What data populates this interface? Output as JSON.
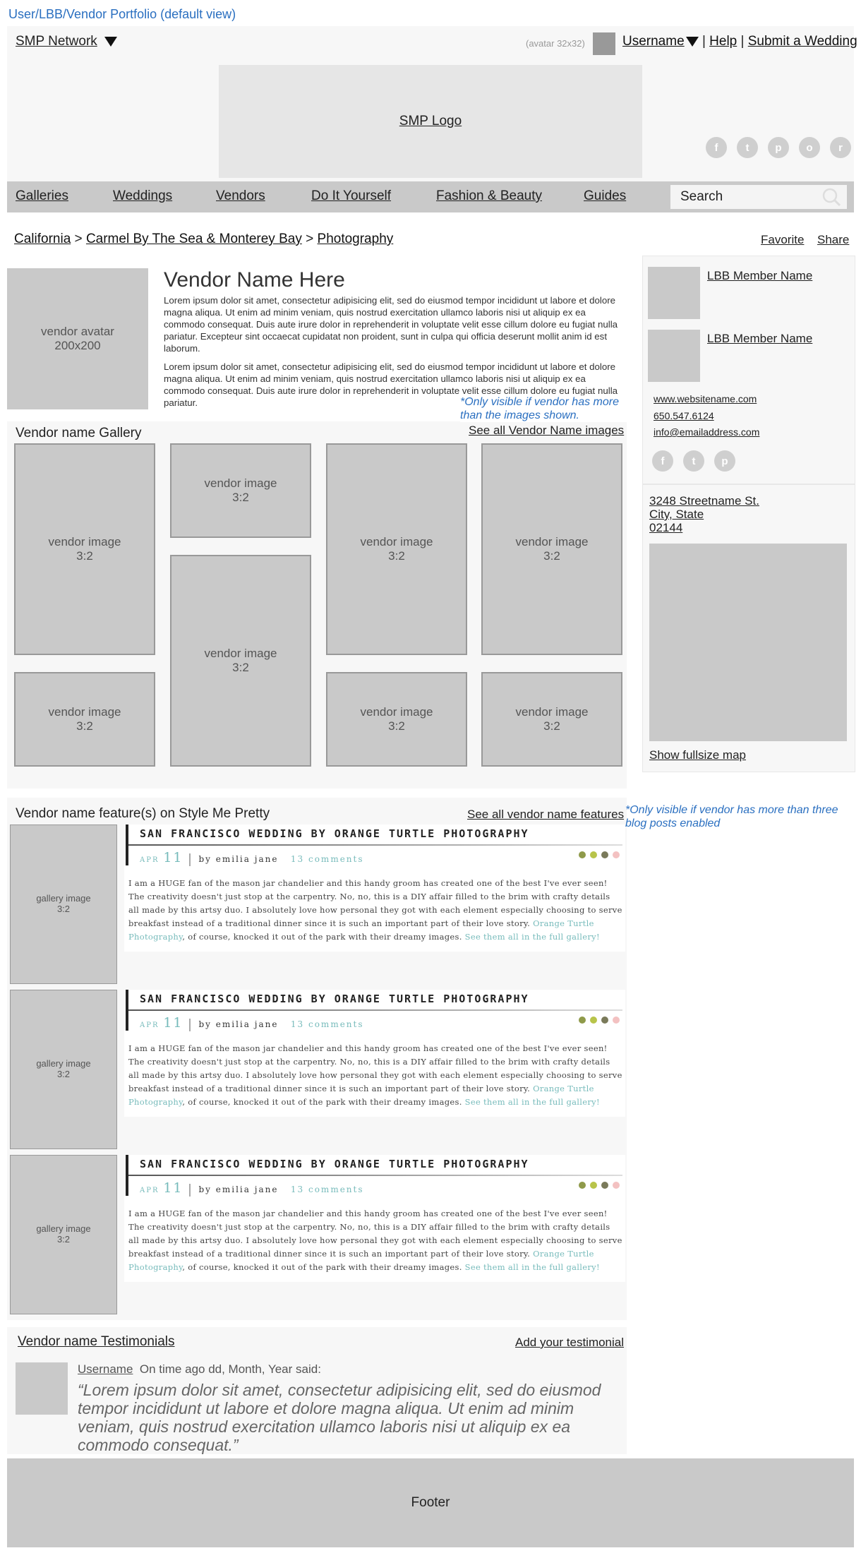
{
  "page_title": "User/LBB/Vendor Portfolio (default view)",
  "header": {
    "network_label": "SMP Network",
    "avatar_note": "(avatar 32x32)",
    "username": "Username",
    "help": "Help",
    "submit": "Submit a Wedding",
    "separator": "|",
    "logo": "SMP Logo",
    "social": [
      "f",
      "t",
      "p",
      "o",
      "r"
    ]
  },
  "nav": {
    "items": [
      "Galleries",
      "Weddings",
      "Vendors",
      "Do It Yourself",
      "Fashion & Beauty",
      "Guides"
    ],
    "search_label": "Search"
  },
  "breadcrumb": {
    "items": [
      "California",
      "Carmel By The Sea & Monterey Bay",
      "Photography"
    ],
    "sep": ">"
  },
  "actions": {
    "favorite": "Favorite",
    "share": "Share"
  },
  "vendor": {
    "avatar": "vendor avatar\n200x200",
    "name": "Vendor Name Here",
    "para1": "Lorem ipsum dolor sit amet, consectetur adipisicing elit, sed do eiusmod tempor incididunt ut labore et dolore magna aliqua. Ut enim ad minim veniam, quis nostrud exercitation ullamco laboris nisi ut aliquip ex ea commodo consequat. Duis aute irure dolor in reprehenderit in voluptate velit esse cillum dolore eu fugiat nulla pariatur. Excepteur sint occaecat cupidatat non proident, sunt in culpa qui officia deserunt mollit anim id est laborum.",
    "para2": "Lorem ipsum dolor sit amet, consectetur adipisicing elit, sed do eiusmod tempor incididunt ut labore et dolore magna aliqua. Ut enim ad minim veniam, quis nostrud exercitation ullamco laboris nisi ut aliquip ex ea commodo consequat. Duis aute irure dolor in reprehenderit in voluptate velit esse cillum dolore eu fugiat nulla pariatur."
  },
  "gallery": {
    "title": "Vendor name Gallery",
    "see_all": "See all Vendor Name images",
    "note": "*Only visible if vendor has more than the images shown.",
    "image_label": "vendor image\n3:2"
  },
  "sidebar": {
    "members": [
      "LBB Member Name",
      "LBB Member Name"
    ],
    "website": "www.websitename.com",
    "phone": "650.547.6124",
    "email": "info@emailaddress.com",
    "social": [
      "f",
      "t",
      "p"
    ],
    "address": [
      "3248 Streetname St.",
      "City, State",
      "02144"
    ],
    "map_link": "Show fullsize map"
  },
  "features": {
    "title": "Vendor name feature(s) on Style Me Pretty",
    "see_all": "See all vendor name features",
    "note": "*Only visible if vendor has more than three blog posts enabled",
    "image_label": "gallery image\n3:2",
    "post": {
      "title": "SAN FRANCISCO WEDDING BY ORANGE TURTLE PHOTOGRAPHY",
      "month": "APR",
      "day": "11",
      "byline": "by emilia jane",
      "comments": "13 comments",
      "body": "I am a HUGE fan of the mason jar chandelier and this handy groom has created one of the best I've ever seen! The creativity doesn't just stop at the carpentry. No, no, this is a DIY affair filled to the brim with crafty details all made by this artsy duo. I absolutely love how personal they got with each element especially choosing to serve breakfast instead of a traditional dinner since it is such an important part of their love story.",
      "link1": "Orange Turtle Photography",
      "body2": ", of course, knocked it out of the park with their dreamy images.",
      "link2": "See them all in the full gallery!",
      "dot_colors": [
        "#8f9a4a",
        "#b8c44a",
        "#7a7a5a",
        "#f3c1c1"
      ]
    }
  },
  "testimonials": {
    "title": "Vendor name Testimonials",
    "add": "Add your testimonial",
    "username": "Username",
    "said": "On time ago dd, Month, Year said:",
    "quote": "“Lorem ipsum dolor sit amet, consectetur adipisicing elit, sed do eiusmod tempor incididunt ut labore et dolore magna aliqua. Ut enim ad minim veniam, quis nostrud exercitation ullamco laboris nisi ut aliquip ex ea commodo consequat.”"
  },
  "footer": "Footer"
}
